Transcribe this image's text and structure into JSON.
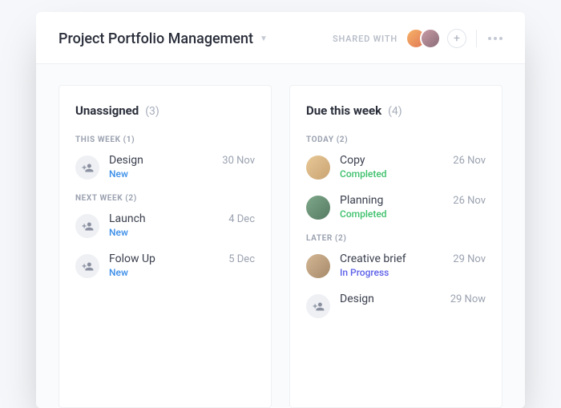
{
  "header": {
    "title": "Project Portfolio Management",
    "shared_with_label": "SHARED WITH",
    "add_label": "+"
  },
  "columns": [
    {
      "title": "Unassigned",
      "count": "(3)",
      "groups": [
        {
          "label": "THIS WEEK (1)",
          "tasks": [
            {
              "title": "Design",
              "date": "30 Nov",
              "status": "New",
              "status_class": "new",
              "assignee": null
            }
          ]
        },
        {
          "label": "NEXT WEEK (2)",
          "tasks": [
            {
              "title": "Launch",
              "date": "4 Dec",
              "status": "New",
              "status_class": "new",
              "assignee": null
            },
            {
              "title": "Folow Up",
              "date": "5 Dec",
              "status": "New",
              "status_class": "new",
              "assignee": null
            }
          ]
        }
      ]
    },
    {
      "title": "Due this week",
      "count": "(4)",
      "groups": [
        {
          "label": "TODAY (2)",
          "tasks": [
            {
              "title": "Copy",
              "date": "26 Nov",
              "status": "Completed",
              "status_class": "completed",
              "assignee": "av1"
            },
            {
              "title": "Planning",
              "date": "26 Nov",
              "status": "Completed",
              "status_class": "completed",
              "assignee": "av2"
            }
          ]
        },
        {
          "label": "LATER (2)",
          "tasks": [
            {
              "title": "Creative brief",
              "date": "29 Nov",
              "status": "In Progress",
              "status_class": "inprogress",
              "assignee": "av3"
            },
            {
              "title": "Design",
              "date": "29 Now",
              "status": "",
              "status_class": "",
              "assignee": null
            }
          ]
        }
      ]
    }
  ]
}
